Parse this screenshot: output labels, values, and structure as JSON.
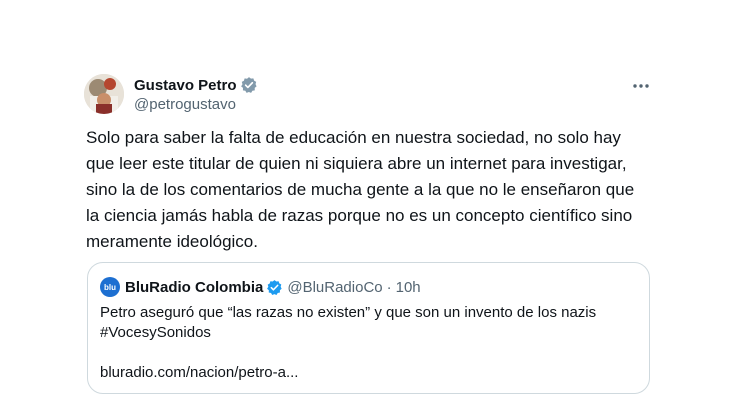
{
  "author": {
    "display_name": "Gustavo Petro",
    "handle": "@petrogustavo",
    "verified_icon": "verified-badge-icon"
  },
  "tweet": {
    "text_lines": [
      "Solo para saber la falta de educación en nuestra sociedad, no solo hay",
      "que leer este titular de quien ni siquiera abre un internet para investigar,",
      "sino la de los comentarios de mucha gente a la que no le enseñaron que",
      "la ciencia jamás habla de razas porque no es un concepto científico sino",
      "meramente ideológico."
    ]
  },
  "quote": {
    "avatar_text": "blu",
    "display_name": "BluRadio Colombia",
    "handle": "@BluRadioCo",
    "separator": "·",
    "time": "10h",
    "text_line1": "Petro aseguró que “las razas no existen” y que son un invento de los nazis",
    "text_line2": "#VocesySonidos",
    "link": "bluradio.com/nacion/petro-a..."
  },
  "colors": {
    "text_primary": "#0f1419",
    "text_secondary": "#536471",
    "verified_blue": "#1d9bf0",
    "border": "#cfd9de",
    "blu_brand": "#1d6fd1"
  }
}
